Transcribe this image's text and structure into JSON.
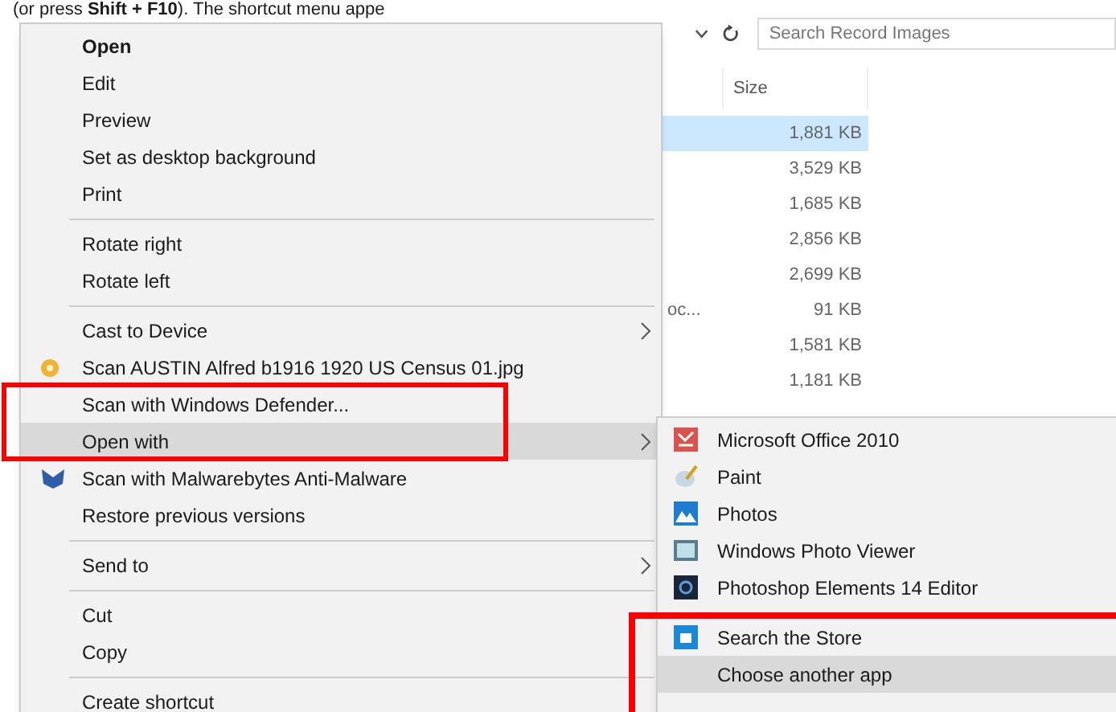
{
  "caption": "(or press **Shift + F10**). The shortcut menu appe",
  "toolbar": {
    "search_placeholder": "Search Record Images"
  },
  "file_list": {
    "columns": [
      "Size"
    ],
    "rows": [
      {
        "size": "1,881 KB",
        "selected": true
      },
      {
        "size": "3,529 KB",
        "selected": false
      },
      {
        "size": "1,685 KB",
        "selected": false
      },
      {
        "size": "2,856 KB",
        "selected": false
      },
      {
        "size": "2,699 KB",
        "selected": false
      },
      {
        "name": "oc...",
        "size": "91 KB",
        "selected": false
      },
      {
        "size": "1,581 KB",
        "selected": false
      },
      {
        "size": "1,181 KB",
        "selected": false
      }
    ]
  },
  "context_menu": {
    "items": [
      {
        "kind": "item",
        "label": "Open",
        "default": true,
        "selected": false,
        "submenu": false
      },
      {
        "kind": "item",
        "label": "Edit",
        "default": false,
        "selected": false,
        "submenu": false
      },
      {
        "kind": "item",
        "label": "Preview",
        "default": false,
        "selected": false,
        "submenu": false
      },
      {
        "kind": "item",
        "label": "Set as desktop background",
        "default": false,
        "selected": false,
        "submenu": false
      },
      {
        "kind": "item",
        "label": "Print",
        "default": false,
        "selected": false,
        "submenu": false
      },
      {
        "kind": "separator"
      },
      {
        "kind": "item",
        "label": "Rotate right",
        "default": false,
        "selected": false,
        "submenu": false
      },
      {
        "kind": "item",
        "label": "Rotate left",
        "default": false,
        "selected": false,
        "submenu": false
      },
      {
        "kind": "separator"
      },
      {
        "kind": "item",
        "label": "Cast to Device",
        "default": false,
        "selected": false,
        "submenu": true
      },
      {
        "kind": "item",
        "label": "Scan AUSTIN Alfred b1916 1920 US Census 01.jpg",
        "default": false,
        "selected": false,
        "submenu": false
      },
      {
        "kind": "item",
        "label": "Scan with Windows Defender...",
        "default": false,
        "selected": false,
        "submenu": false
      },
      {
        "kind": "item",
        "label": "Open with",
        "default": false,
        "selected": true,
        "submenu": true
      },
      {
        "kind": "item",
        "label": "Scan with Malwarebytes Anti-Malware",
        "default": false,
        "selected": false,
        "submenu": false
      },
      {
        "kind": "item",
        "label": "Restore previous versions",
        "default": false,
        "selected": false,
        "submenu": false
      },
      {
        "kind": "separator"
      },
      {
        "kind": "item",
        "label": "Send to",
        "default": false,
        "selected": false,
        "submenu": true
      },
      {
        "kind": "separator"
      },
      {
        "kind": "item",
        "label": "Cut",
        "default": false,
        "selected": false,
        "submenu": false
      },
      {
        "kind": "item",
        "label": "Copy",
        "default": false,
        "selected": false,
        "submenu": false
      },
      {
        "kind": "separator"
      },
      {
        "kind": "item",
        "label": "Create shortcut",
        "default": false,
        "selected": false,
        "submenu": false
      }
    ]
  },
  "open_with_submenu": {
    "items": [
      {
        "kind": "item",
        "label": "Microsoft Office 2010",
        "selected": false
      },
      {
        "kind": "item",
        "label": "Paint",
        "selected": false
      },
      {
        "kind": "item",
        "label": "Photos",
        "selected": false
      },
      {
        "kind": "item",
        "label": "Windows Photo Viewer",
        "selected": false
      },
      {
        "kind": "item",
        "label": "Photoshop Elements 14 Editor",
        "selected": false
      },
      {
        "kind": "separator"
      },
      {
        "kind": "item",
        "label": "Search the Store",
        "selected": false
      },
      {
        "kind": "item",
        "label": "Choose another app",
        "selected": true
      }
    ]
  }
}
